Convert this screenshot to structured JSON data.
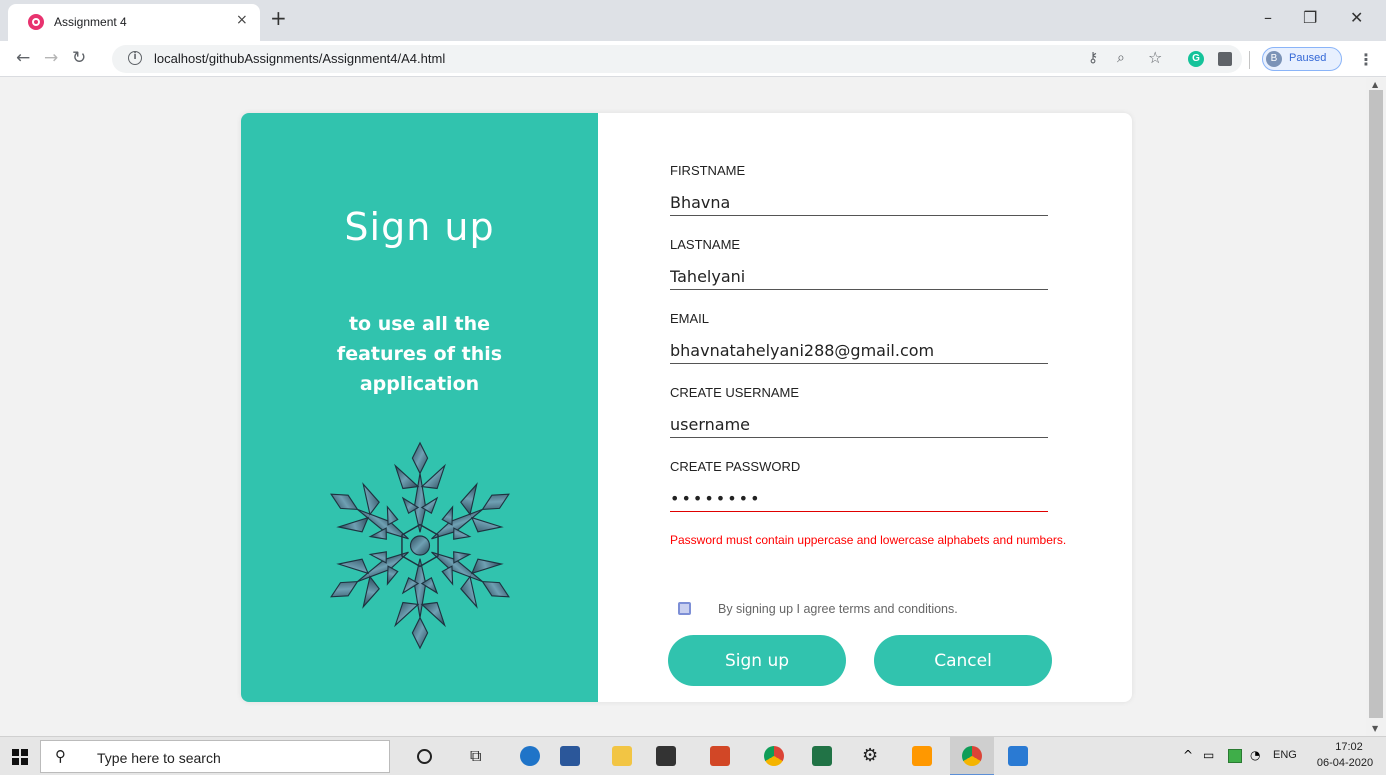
{
  "browser": {
    "tab_title": "Assignment 4",
    "tab_close": "×",
    "new_tab": "+",
    "url": "localhost/githubAssignments/Assignment4/A4.html",
    "profile_initial": "B",
    "profile_label": "Paused",
    "window_min": "–",
    "window_restore": "❐",
    "window_close": "✕"
  },
  "form": {
    "heading": "Sign up",
    "subtitle": "to use all the features of this application",
    "firstname_label": "FIRSTNAME",
    "firstname_value": "Bhavna",
    "lastname_label": "LASTNAME",
    "lastname_value": "Tahelyani",
    "email_label": "EMAIL",
    "email_value": "bhavnatahelyani288@gmail.com",
    "username_label": "CREATE USERNAME",
    "username_value": "username",
    "password_label": "CREATE PASSWORD",
    "password_value": "********",
    "password_error": "Password must contain uppercase and lowercase alphabets and numbers.",
    "terms_label": "By signing up I agree terms and conditions.",
    "signup_button": "Sign up",
    "cancel_button": "Cancel"
  },
  "taskbar": {
    "search_placeholder": "Type here to search",
    "language": "ENG",
    "time": "17:02",
    "date": "06-04-2020"
  },
  "colors": {
    "accent": "#31c3ae",
    "error": "#ff0000"
  }
}
